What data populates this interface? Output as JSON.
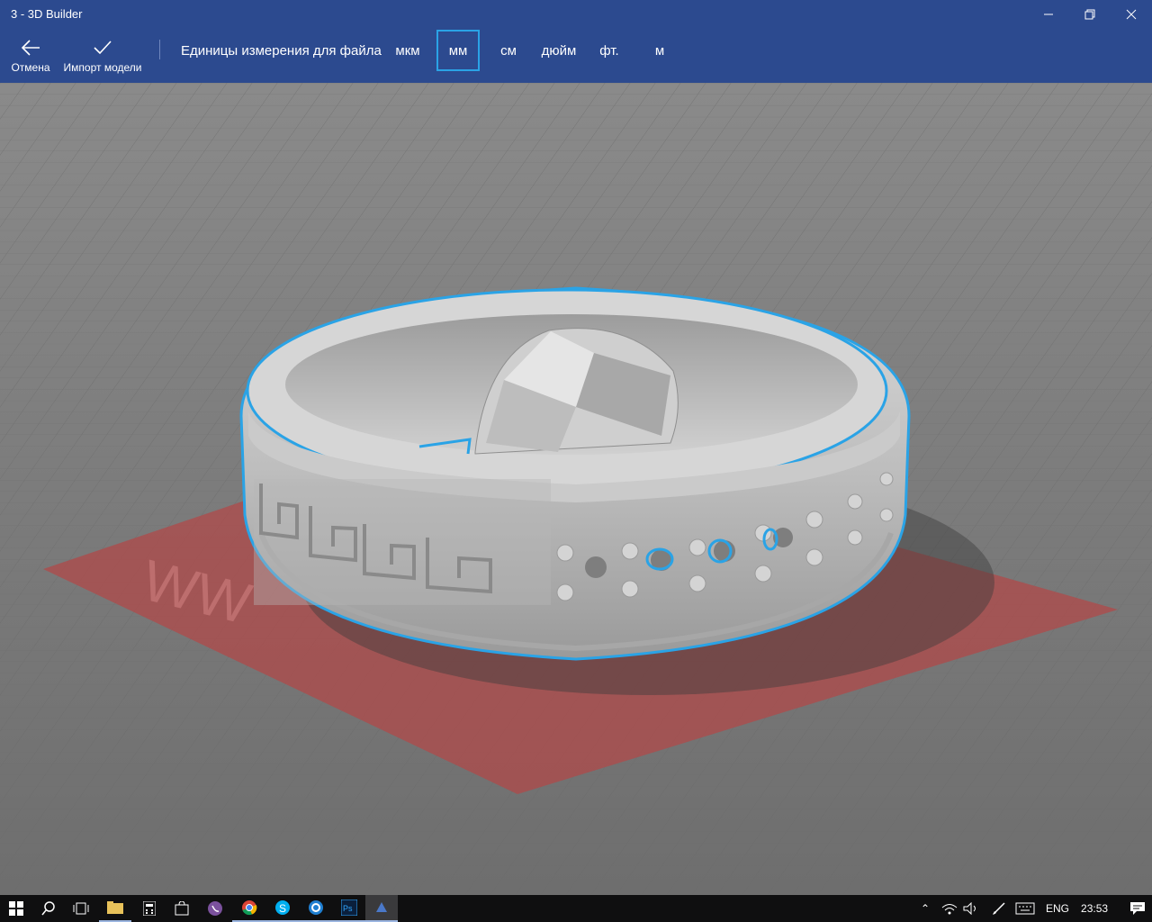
{
  "window": {
    "title": "3 - 3D Builder"
  },
  "toolbar": {
    "cancel_label": "Отмена",
    "import_label": "Импорт модели",
    "units_label": "Единицы измерения для файла",
    "units": [
      {
        "label": "мкм",
        "selected": false
      },
      {
        "label": "мм",
        "selected": true
      },
      {
        "label": "см",
        "selected": false
      },
      {
        "label": "дюйм",
        "selected": false
      },
      {
        "label": "фт.",
        "selected": false
      },
      {
        "label": "м",
        "selected": false
      }
    ]
  },
  "viewport": {
    "plate_text": "WW"
  },
  "colors": {
    "accent": "#2c4a8f",
    "selection": "#2aa3e6",
    "plate": "#b04a4a",
    "floor": "#7a7a7a"
  },
  "taskbar": {
    "apps": [
      "start-icon",
      "search-icon",
      "task-view-icon",
      "file-explorer-icon",
      "calculator-icon",
      "store-icon",
      "viber-icon",
      "chrome-icon",
      "skype-icon",
      "app-icon",
      "photoshop-icon",
      "3d-builder-icon"
    ],
    "language": "ENG",
    "time": "23:53"
  }
}
